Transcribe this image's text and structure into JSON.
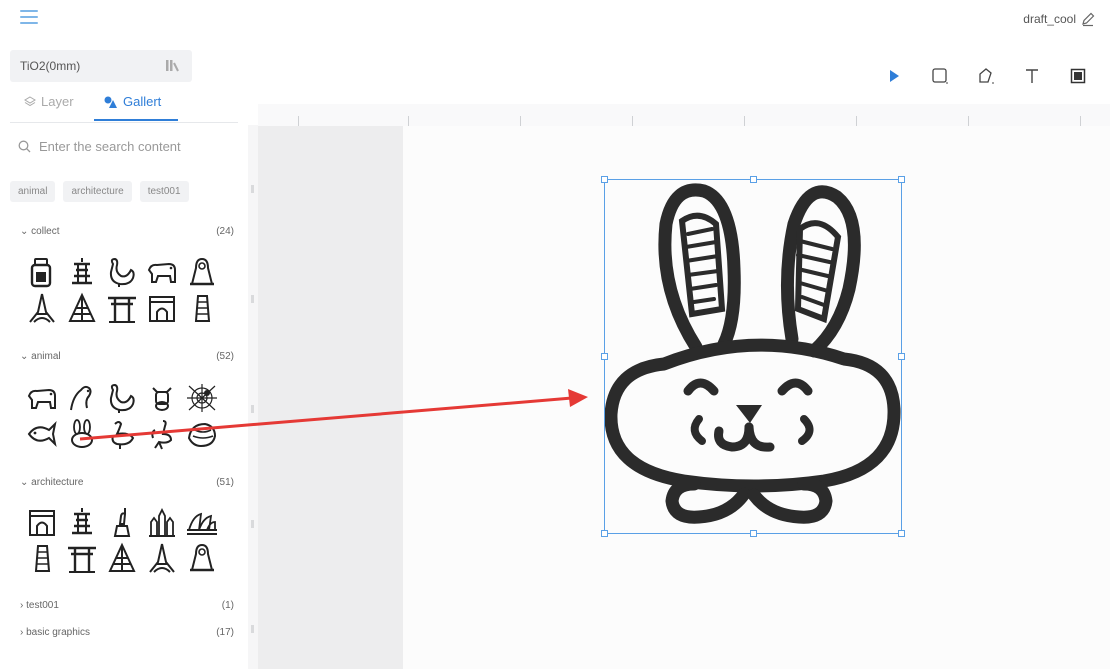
{
  "header": {
    "menu_icon": "hamburger-menu-icon",
    "project_name": "draft_cool",
    "edit_icon": "pencil-icon"
  },
  "material": {
    "label": "TiO2(0mm)",
    "icon": "material-library-icon"
  },
  "tabs": [
    {
      "label": "Layer",
      "icon": "layers-icon",
      "active": false
    },
    {
      "label": "Gallert",
      "icon": "gallery-shapes-icon",
      "active": true
    }
  ],
  "search": {
    "placeholder": "Enter the search content",
    "icon": "search-icon"
  },
  "tags": [
    "animal",
    "architecture",
    "test001"
  ],
  "sections": [
    {
      "label": "collect",
      "count": "(24)",
      "expanded": true,
      "items": [
        "bottle-icon",
        "pagoda-icon",
        "hen-icon",
        "tiger-icon",
        "sphinx-icon",
        "eiffel-tower-icon",
        "pyramid-icon",
        "torii-gate-icon",
        "arc-de-triomphe-icon",
        "leaning-tower-icon"
      ]
    },
    {
      "label": "animal",
      "count": "(52)",
      "expanded": true,
      "items": [
        "tiger-icon",
        "rooster-icon",
        "hen-icon",
        "cow-icon",
        "spider-web-icon",
        "fish-icon",
        "rabbit-icon",
        "swan-icon",
        "ostrich-icon",
        "pangolin-icon"
      ]
    },
    {
      "label": "architecture",
      "count": "(51)",
      "expanded": true,
      "items": [
        "arc-de-triomphe-icon",
        "pagoda-icon",
        "statue-of-liberty-icon",
        "castle-icon",
        "opera-house-icon",
        "leaning-tower-icon",
        "torii-gate-icon",
        "pyramid-icon",
        "eiffel-tower-icon",
        "sphinx-icon"
      ]
    },
    {
      "label": "test001",
      "count": "(1)",
      "expanded": false,
      "items": []
    },
    {
      "label": "basic graphics",
      "count": "(17)",
      "expanded": false,
      "items": []
    }
  ],
  "toolbar": [
    "select-arrow-icon",
    "rectangle-tool-icon",
    "polygon-tool-icon",
    "text-tool-icon",
    "frame-tool-icon"
  ],
  "accent_color": "#2f7ed8",
  "arrow_color": "#e53935",
  "canvas_object": "rabbit-icon"
}
